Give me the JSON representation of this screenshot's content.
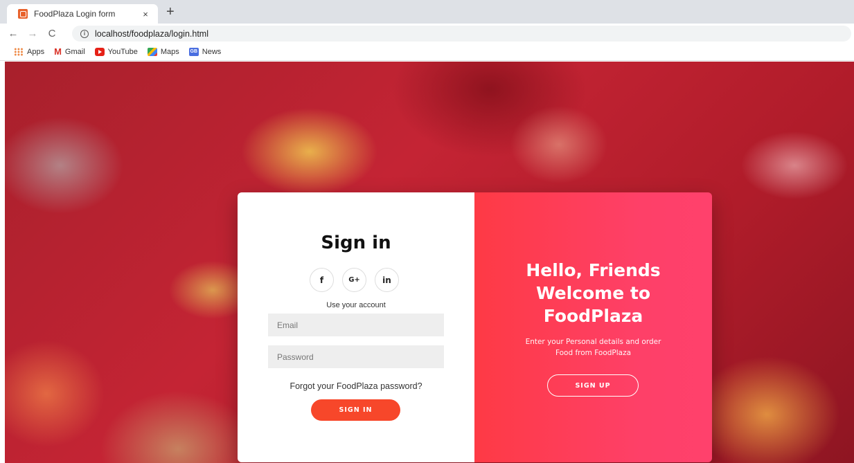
{
  "browser": {
    "tab_title": "FoodPlaza Login form",
    "tab_close": "×",
    "new_tab": "+",
    "back": "←",
    "forward": "→",
    "reload": "C",
    "info": "i",
    "url": "localhost/foodplaza/login.html",
    "bookmarks": [
      "Apps",
      "Gmail",
      "YouTube",
      "Maps",
      "News"
    ],
    "gmail_glyph": "M",
    "news_glyph": "GB"
  },
  "signin": {
    "title": "Sign in",
    "socials": [
      "f",
      "G+",
      "in"
    ],
    "use_account": "Use your account",
    "email_placeholder": "Email",
    "password_placeholder": "Password",
    "forgot": "Forgot your FoodPlaza password?",
    "button": "SIGN IN"
  },
  "signup": {
    "welcome_line1": "Hello, Friends",
    "welcome_line2": "Welcome to",
    "welcome_line3": "FoodPlaza",
    "text_line1": "Enter your Personal details and order",
    "text_line2": "Food from FoodPlaza",
    "button": "SIGN UP"
  },
  "colors": {
    "accent": "#f7472a",
    "overlay_gradient_start": "#fe3a45",
    "overlay_gradient_end": "#ff416c"
  }
}
